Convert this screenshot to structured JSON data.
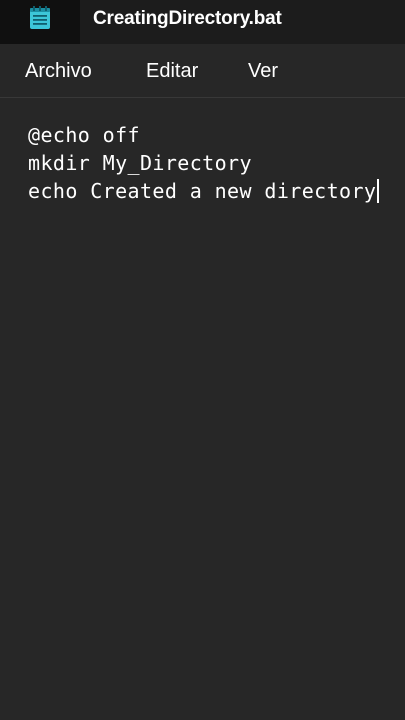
{
  "tab": {
    "title": "CreatingDirectory.bat",
    "icon": "notepad-icon"
  },
  "menu": {
    "archivo": "Archivo",
    "editar": "Editar",
    "ver": "Ver"
  },
  "editor": {
    "lines": [
      "@echo off",
      "mkdir My_Directory",
      "echo Created a new directory"
    ]
  },
  "colors": {
    "background": "#272727",
    "tabstrip": "#1c1c1c",
    "icon_accent": "#3cc6d8",
    "text": "#ffffff"
  }
}
